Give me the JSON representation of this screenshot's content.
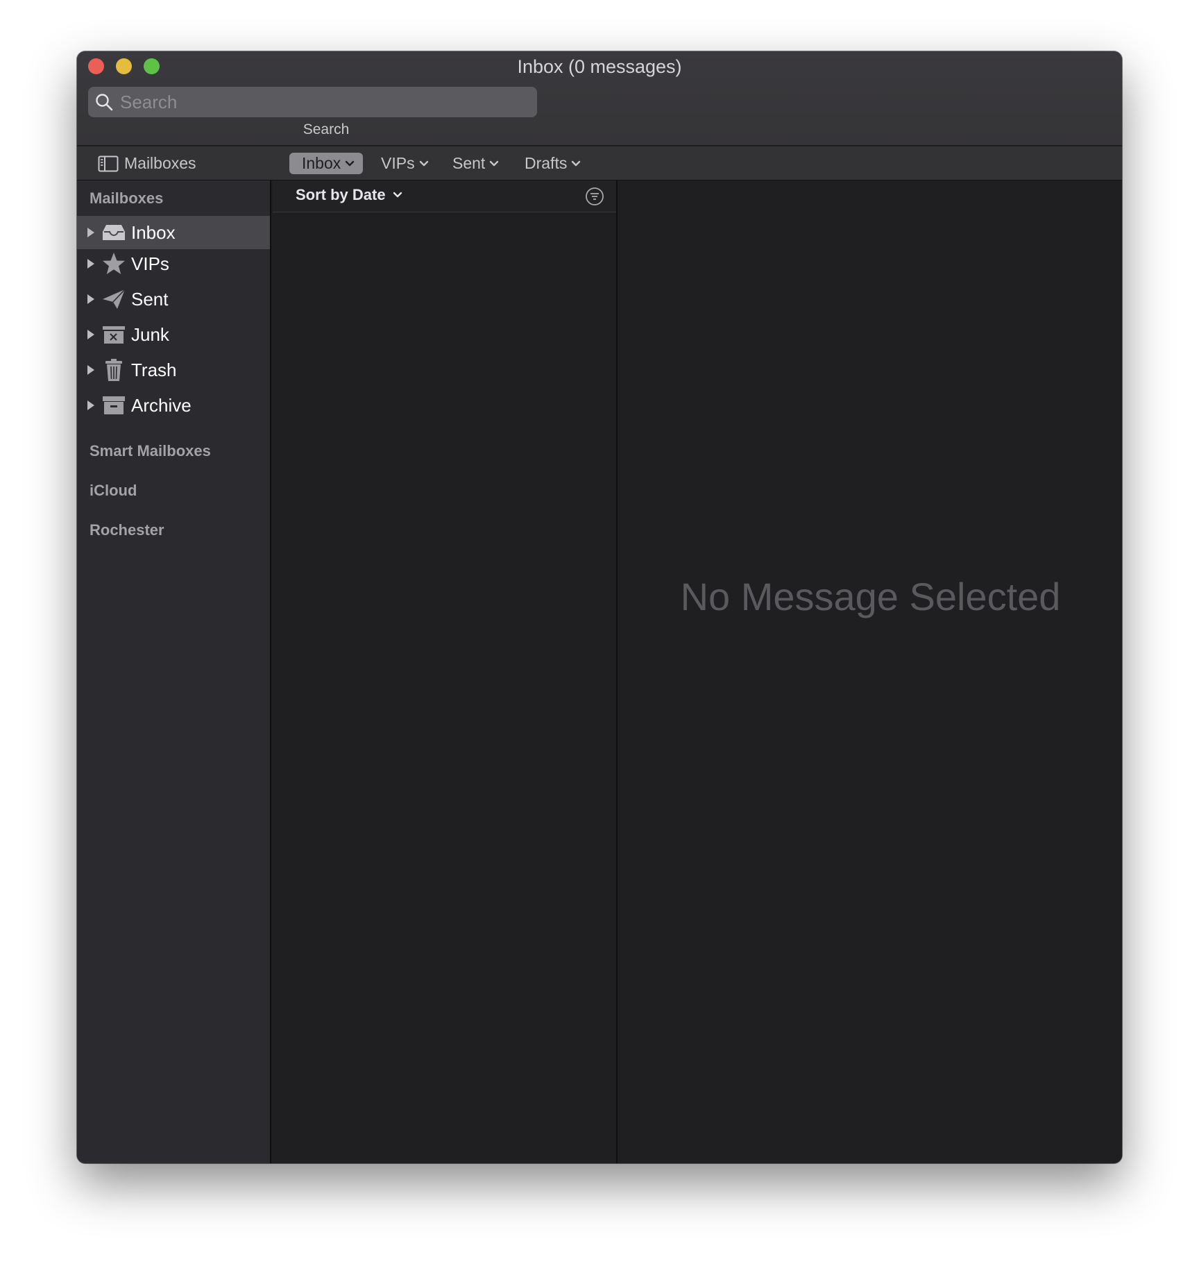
{
  "window": {
    "title": "Inbox (0 messages)"
  },
  "search": {
    "placeholder": "Search",
    "caption": "Search"
  },
  "favorites": {
    "mailboxes_label": "Mailboxes",
    "items": [
      {
        "label": "Inbox",
        "selected": true
      },
      {
        "label": "VIPs",
        "selected": false
      },
      {
        "label": "Sent",
        "selected": false
      },
      {
        "label": "Drafts",
        "selected": false
      }
    ]
  },
  "sidebar": {
    "section_mailboxes": "Mailboxes",
    "items": [
      {
        "label": "Inbox",
        "icon": "inbox-icon",
        "selected": true
      },
      {
        "label": "VIPs",
        "icon": "star-icon",
        "selected": false
      },
      {
        "label": "Sent",
        "icon": "paper-plane-icon",
        "selected": false
      },
      {
        "label": "Junk",
        "icon": "junk-icon",
        "selected": false
      },
      {
        "label": "Trash",
        "icon": "trash-icon",
        "selected": false
      },
      {
        "label": "Archive",
        "icon": "archive-icon",
        "selected": false
      }
    ],
    "section_smart": "Smart Mailboxes",
    "section_icloud": "iCloud",
    "section_rochester": "Rochester"
  },
  "message_list": {
    "sort_label": "Sort by Date"
  },
  "preview": {
    "empty_text": "No Message Selected"
  },
  "colors": {
    "close": "#ec5f57",
    "minimize": "#e4bd3d",
    "maximize": "#5fc248",
    "selected_row": "#48474c",
    "selected_fav": "#8c8b8f"
  }
}
